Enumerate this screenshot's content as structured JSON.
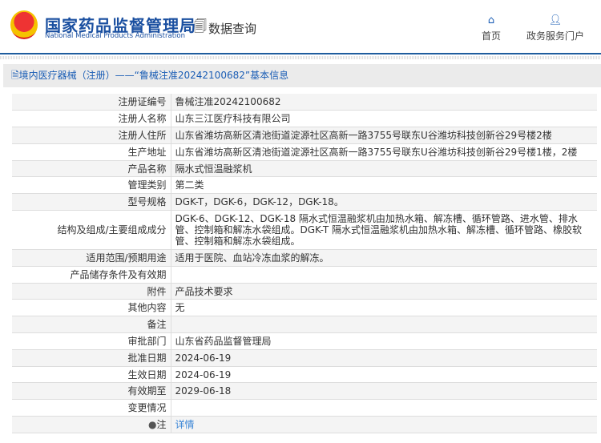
{
  "header": {
    "logo_cn": "国家药品监督管理局",
    "logo_en": "National Medical Products Administration",
    "query": "数据查询",
    "nav": [
      {
        "label": "首页",
        "icon": "home-icon"
      },
      {
        "label": "政务服务门户",
        "icon": "user-icon"
      }
    ]
  },
  "title": "境内医疗器械（注册）——“鲁械注准20242100682”基本信息",
  "rows": [
    {
      "k": "注册证编号",
      "v": "鲁械注准20242100682"
    },
    {
      "k": "注册人名称",
      "v": "山东三江医疗科技有限公司"
    },
    {
      "k": "注册人住所",
      "v": "山东省潍坊高新区清池街道淀源社区高新一路3755号联东U谷潍坊科技创新谷29号楼2楼"
    },
    {
      "k": "生产地址",
      "v": "山东省潍坊高新区清池街道淀源社区高新一路3755号联东U谷潍坊科技创新谷29号楼1楼，2楼"
    },
    {
      "k": "产品名称",
      "v": "隔水式恒温融浆机"
    },
    {
      "k": "管理类别",
      "v": "第二类"
    },
    {
      "k": "型号规格",
      "v": "DGK-T，DGK-6，DGK-12，DGK-18。"
    },
    {
      "k": "结构及组成/主要组成成分",
      "v": "DGK-6、DGK-12、DGK-18 隔水式恒温融浆机由加热水箱、解冻槽、循环管路、进水管、排水管、控制箱和解冻水袋组成。DGK-T 隔水式恒温融浆机由加热水箱、解冻槽、循环管路、橡胶软管、控制箱和解冻水袋组成。"
    },
    {
      "k": "适用范围/预期用途",
      "v": "适用于医院、血站冷冻血浆的解冻。"
    },
    {
      "k": "产品储存条件及有效期",
      "v": ""
    },
    {
      "k": "附件",
      "v": "产品技术要求"
    },
    {
      "k": "其他内容",
      "v": "无"
    },
    {
      "k": "备注",
      "v": ""
    },
    {
      "k": "审批部门",
      "v": "山东省药品监督管理局"
    },
    {
      "k": "批准日期",
      "v": "2024-06-19"
    },
    {
      "k": "生效日期",
      "v": "2024-06-19"
    },
    {
      "k": "有效期至",
      "v": "2029-06-18"
    },
    {
      "k": "变更情况",
      "v": ""
    }
  ],
  "note": {
    "k": "注",
    "link": "详情"
  }
}
